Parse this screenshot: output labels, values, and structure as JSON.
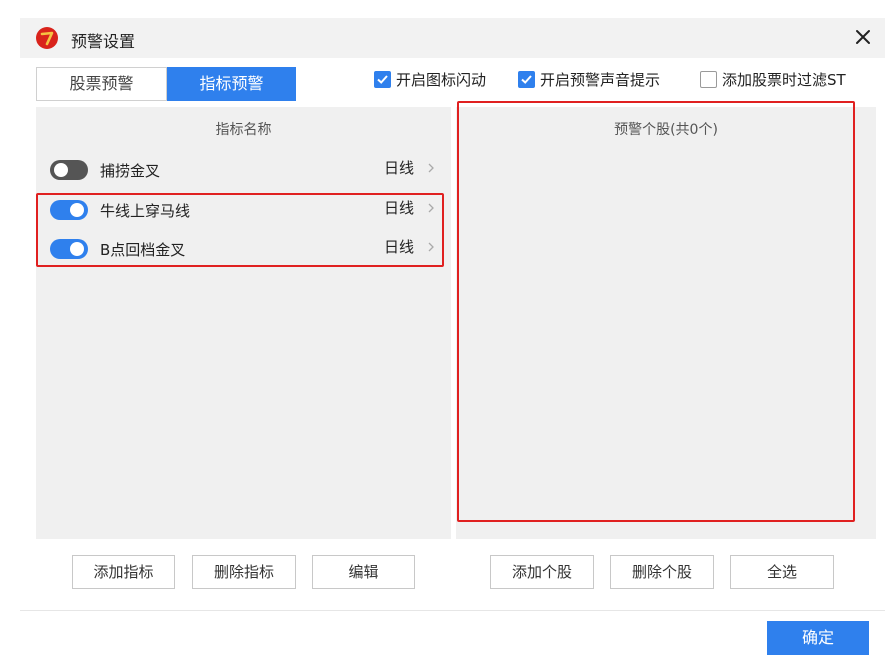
{
  "dialog": {
    "title": "预警设置",
    "logo_icon": "app-logo-icon",
    "close_icon": "close-icon"
  },
  "tabs": [
    {
      "label": "股票预警",
      "active": false
    },
    {
      "label": "指标预警",
      "active": true
    }
  ],
  "options": [
    {
      "label": "开启图标闪动",
      "checked": true
    },
    {
      "label": "开启预警声音提示",
      "checked": true
    },
    {
      "label": "添加股票时过滤ST",
      "checked": false
    }
  ],
  "indicator_panel": {
    "header": "指标名称",
    "rows": [
      {
        "name": "捕捞金叉",
        "period": "日线",
        "enabled": false
      },
      {
        "name": "牛线上穿马线",
        "period": "日线",
        "enabled": true
      },
      {
        "name": "B点回档金叉",
        "period": "日线",
        "enabled": true
      }
    ]
  },
  "stock_panel": {
    "header": "预警个股(共0个)"
  },
  "left_buttons": [
    "添加指标",
    "删除指标",
    "编辑"
  ],
  "right_buttons": [
    "添加个股",
    "删除个股",
    "全选"
  ],
  "ok_button": "确定",
  "colors": {
    "accent": "#2f80ed",
    "highlight": "#e02020",
    "panel_bg": "#f0f0f0",
    "title_bg": "#f2f2f2"
  }
}
